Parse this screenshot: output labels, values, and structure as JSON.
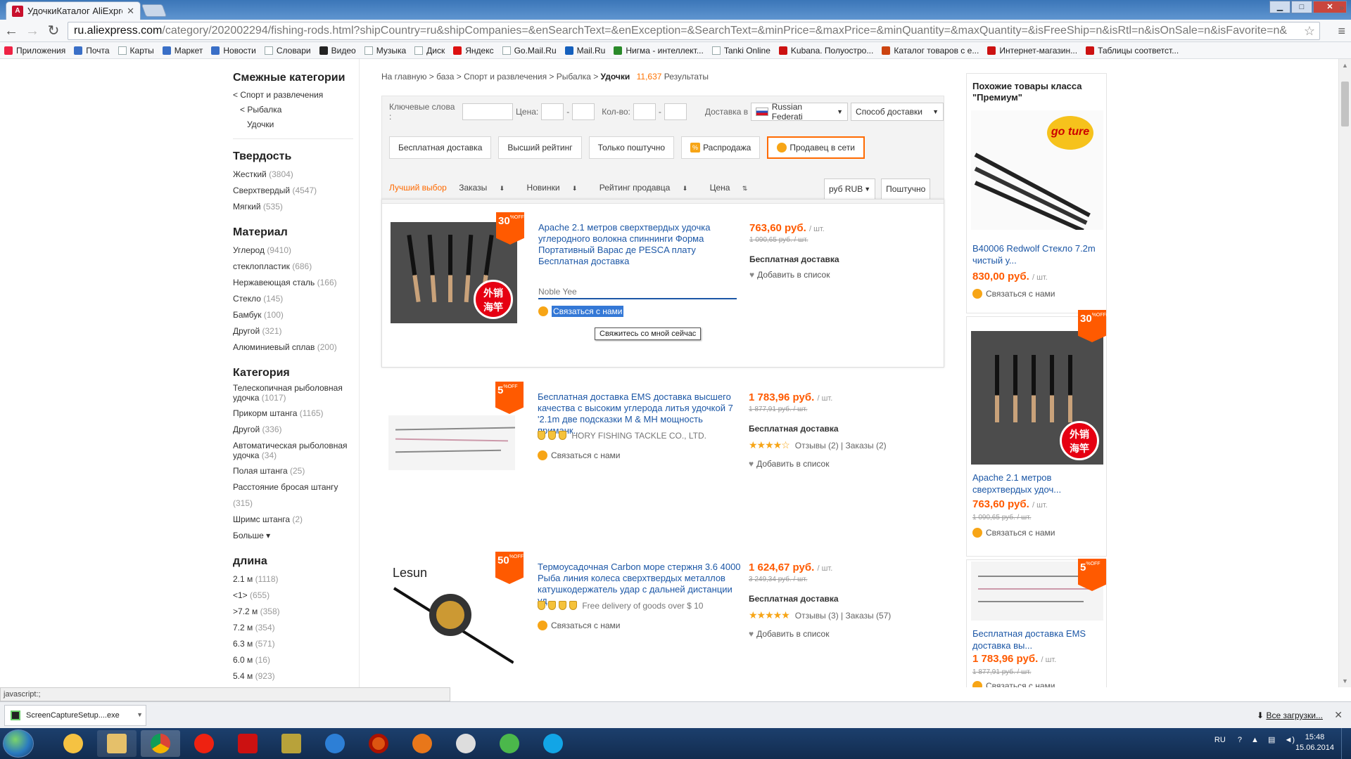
{
  "browser": {
    "tab_title": "УдочкиКаталог AliExpress",
    "url_host": "ru.aliexpress.com",
    "url_path": "/category/202002294/fishing-rods.html?shipCountry=ru&shipCompanies=&enSearchText=&enException=&SearchText=&minPrice=&maxPrice=&minQuantity=&maxQuantity=&isFreeShip=n&isRtl=n&isOnSale=n&isFavorite=n&",
    "bookmarks": [
      {
        "label": "Приложения",
        "color": "#e24"
      },
      {
        "label": "Почта",
        "color": "#3a6fc7"
      },
      {
        "label": "Карты",
        "color": ""
      },
      {
        "label": "Маркет",
        "color": "#3a6fc7"
      },
      {
        "label": "Новости",
        "color": "#3a6fc7"
      },
      {
        "label": "Словари",
        "color": ""
      },
      {
        "label": "Видео",
        "color": "#222"
      },
      {
        "label": "Музыка",
        "color": ""
      },
      {
        "label": "Диск",
        "color": ""
      },
      {
        "label": "Яндекс",
        "color": "#d11"
      },
      {
        "label": "Go.Mail.Ru",
        "color": ""
      },
      {
        "label": "Mail.Ru",
        "color": "#1560bd"
      },
      {
        "label": "Нигма - интеллект...",
        "color": "#2a8a2a"
      },
      {
        "label": "Tanki Online",
        "color": ""
      },
      {
        "label": "Kubana. Полуостро...",
        "color": "#c11"
      },
      {
        "label": "Каталог товаров с е...",
        "color": "#c41"
      },
      {
        "label": "Интернет-магазин...",
        "color": "#c11"
      },
      {
        "label": "Таблицы соответст...",
        "color": "#c11"
      }
    ],
    "status_text": "javascript:;"
  },
  "sidebar": {
    "related_title": "Смежные категории",
    "related": [
      "< Спорт и развлечения",
      "< Рыбалка",
      "Удочки"
    ],
    "sections": [
      {
        "title": "Твердость",
        "items": [
          {
            "label": "Жесткий",
            "count": "(3804)"
          },
          {
            "label": "Сверхтвердый",
            "count": "(4547)"
          },
          {
            "label": "Мягкий",
            "count": "(535)"
          }
        ]
      },
      {
        "title": "Материал",
        "items": [
          {
            "label": "Углерод",
            "count": "(9410)"
          },
          {
            "label": "стеклопластик",
            "count": "(686)"
          },
          {
            "label": "Нержавеющая сталь",
            "count": "(166)"
          },
          {
            "label": "Стекло",
            "count": "(145)"
          },
          {
            "label": "Бамбук",
            "count": "(100)"
          },
          {
            "label": "Другой",
            "count": "(321)"
          },
          {
            "label": "Алюминиевый сплав",
            "count": "(200)"
          }
        ]
      },
      {
        "title": "Категория",
        "items": [
          {
            "label": "Телескопичная рыболовная удочка",
            "count": "(1017)"
          },
          {
            "label": "Прикорм штанга",
            "count": "(1165)"
          },
          {
            "label": "Другой",
            "count": "(336)"
          },
          {
            "label": "Автоматическая рыболовная удочка",
            "count": "(34)"
          },
          {
            "label": "Полая штанга",
            "count": "(25)"
          },
          {
            "label": "Расстояние бросая штангу",
            "count": "(315)"
          },
          {
            "label": "Шримс штанга",
            "count": "(2)"
          }
        ],
        "more": "Больше"
      },
      {
        "title": "длина",
        "items": [
          {
            "label": "2.1 м",
            "count": "(1118)"
          },
          {
            "label": "<1>",
            "count": "(655)"
          },
          {
            "label": ">7.2 м",
            "count": "(358)"
          },
          {
            "label": "7.2 м",
            "count": "(354)"
          },
          {
            "label": "6.3 м",
            "count": "(571)"
          },
          {
            "label": "6.0 м",
            "count": "(16)"
          },
          {
            "label": "5.4 м",
            "count": "(923)"
          }
        ],
        "more": "Больше"
      }
    ]
  },
  "breadcrumb": {
    "parts": "На главную > база > Спорт и развлечения > Рыбалка >",
    "current": "Удочки",
    "count": "11,637",
    "results": "Результаты"
  },
  "filters": {
    "keywords_label": "Ключевые слова :",
    "price_label": "Цена:",
    "qty_label": "Кол-во:",
    "dash": "-",
    "delivery_label": "Доставка в",
    "country": "Russian Federati",
    "ship_method": "Способ доставки",
    "buttons": [
      "Бесплатная доставка",
      "Высший рейтинг",
      "Только поштучно",
      "Распродажа",
      "Продавец в сети"
    ]
  },
  "sort": {
    "items": [
      "Лучший выбор",
      "Заказы",
      "Новинки",
      "Рейтинг продавца",
      "Цена"
    ],
    "currency": "руб RUB",
    "unit": "Поштучно"
  },
  "products": [
    {
      "discount": "30",
      "title": "Apache 2.1 метров сверхтвердых удочка углеродного волокна спиннинги Форма Портативный Варас де PESCA плату Бесплатная доставка",
      "seller": "Noble Yee",
      "contact": "Связаться с нами",
      "tooltip": "Свяжитесь со мной сейчас",
      "price": "763,60 руб.",
      "unit": "/ шт.",
      "old_price": "1 090,65 руб. / шт.",
      "shipping": "Бесплатная доставка",
      "wishlist": "Добавить в список"
    },
    {
      "discount": "5",
      "title": "Бесплатная доставка EMS доставка высшего качества с высоким углерода литья удочкой 7 '2.1m две подсказки M & MH мощность приманк...",
      "seller": "HORY FISHING TACKLE CO., LTD.",
      "contact": "Связаться с нами",
      "price": "1 783,96 руб.",
      "unit": "/ шт.",
      "old_price": "1 877,91 руб. / шт.",
      "shipping": "Бесплатная доставка",
      "rating_text": "Отзывы (2) | Заказы (2)",
      "wishlist": "Добавить в список"
    },
    {
      "discount": "50",
      "brand": "Lesun",
      "title": "Термоусадочная Carbon море стержня 3.6 4000 Рыба линия колеса сверхтвердых металлов катушкодержатель удар с дальней дистанции уд...",
      "seller": "Free delivery of goods over $ 10",
      "contact": "Связаться с нами",
      "price": "1 624,67 руб.",
      "unit": "/ шт.",
      "old_price": "3 249,34 руб. / шт.",
      "shipping": "Бесплатная доставка",
      "rating_text": "Отзывы (3) | Заказы (57)",
      "wishlist": "Добавить в список"
    }
  ],
  "right": {
    "title": "Похожие товары класса \"Премиум\"",
    "items": [
      {
        "logo": "go ture",
        "title": "B40006 Redwolf Стекло 7.2m чистый у...",
        "price": "830,00 руб.",
        "unit": "/ шт.",
        "contact": "Связаться с нами"
      },
      {
        "discount": "30",
        "title": "Apache 2.1 метров сверхтвердых удоч...",
        "price": "763,60 руб.",
        "unit": "/ шт.",
        "old_price": "1 090,65 руб. / шт.",
        "contact": "Связаться с нами"
      },
      {
        "discount": "5",
        "title": "Бесплатная доставка EMS доставка вы...",
        "price": "1 783,96 руб.",
        "unit": "/ шт.",
        "old_price": "1 877,91 руб. / шт.",
        "contact": "Связаться с нами"
      }
    ]
  },
  "downloads": {
    "file": "ScreenCaptureSetup....exe",
    "all": "Все загрузки..."
  },
  "taskbar": {
    "lang": "RU",
    "time": "15:48",
    "date": "15.06.2014"
  }
}
